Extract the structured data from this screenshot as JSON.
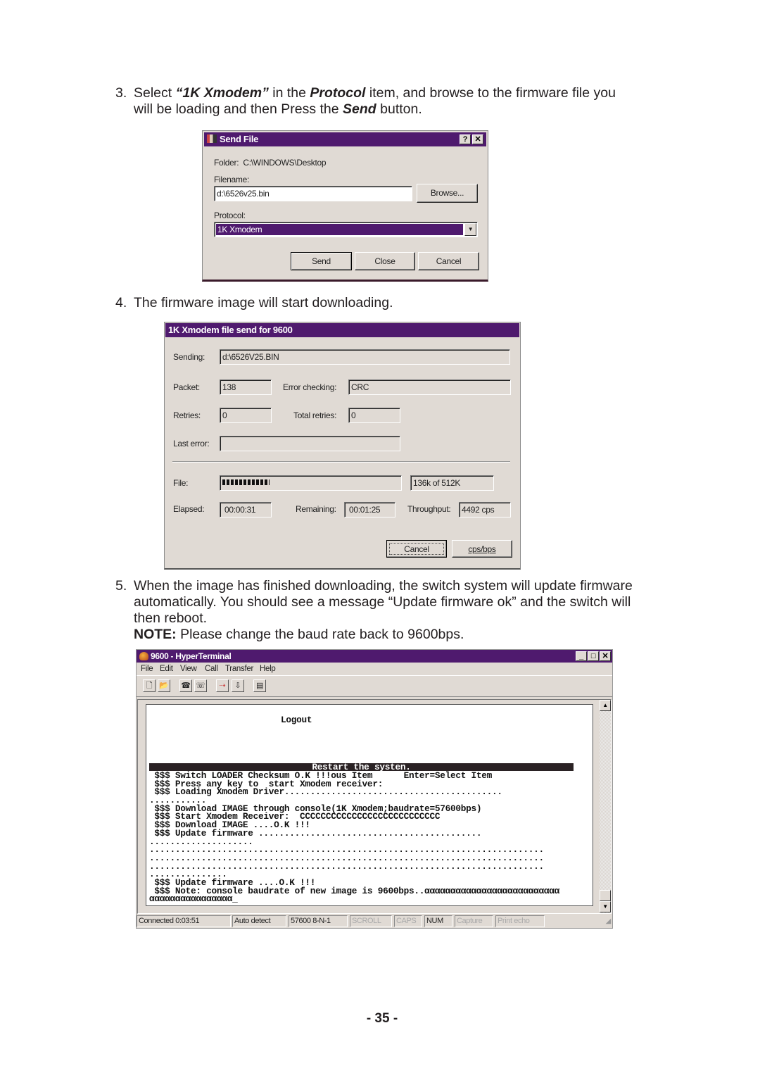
{
  "steps": {
    "step3": {
      "number": "3.",
      "line1_a": "Select ",
      "line1_b": "“1K Xmodem”",
      "line1_c": " in the ",
      "line1_d": "Protocol",
      "line1_e": " item, and browse to the firmware file you",
      "line2_a": "will be loading and then Press the ",
      "line2_b": "Send",
      "line2_c": " button."
    },
    "step4": {
      "number": "4.",
      "text": "The firmware image will start downloading."
    },
    "step5": {
      "number": "5.",
      "line1": "When the image has finished downloading, the switch system will update firmware",
      "line2": "automatically. You should see a message “Update firmware ok” and the switch will",
      "line3": "then reboot.",
      "note_label": "NOTE:",
      "note_text": " Please change the baud rate back to 9600bps."
    }
  },
  "send_file_dialog": {
    "title": "Send File",
    "help_button": "?",
    "close_button": "✕",
    "folder_label": "Folder:",
    "folder_value": "C:\\WINDOWS\\Desktop",
    "filename_label": "Filename:",
    "filename_value": "d:\\6526v25.bin",
    "browse_button": "Browse...",
    "protocol_label": "Protocol:",
    "protocol_value": "1K Xmodem",
    "send_button": "Send",
    "close_btn": "Close",
    "cancel_button": "Cancel"
  },
  "xmodem_dialog": {
    "title": "1K Xmodem file send for 9600",
    "sending_label": "Sending:",
    "sending_value": "d:\\6526V25.BIN",
    "packet_label": "Packet:",
    "packet_value": "138",
    "error_checking_label": "Error checking:",
    "error_checking_value": "CRC",
    "retries_label": "Retries:",
    "retries_value": "0",
    "total_retries_label": "Total retries:",
    "total_retries_value": "0",
    "last_error_label": "Last error:",
    "last_error_value": "",
    "file_label": "File:",
    "file_progress_fraction": 0.2656,
    "file_size_value": "136k of 512K",
    "elapsed_label": "Elapsed:",
    "elapsed_value": "00:00:31",
    "remaining_label": "Remaining:",
    "remaining_value": "00:01:25",
    "throughput_label": "Throughput:",
    "throughput_value": "4492 cps",
    "cancel_button": "Cancel",
    "cps_bps_button": "cps/bps"
  },
  "hyperterminal": {
    "title": "9600 - HyperTerminal",
    "menu": [
      "File",
      "Edit",
      "View",
      "Call",
      "Transfer",
      "Help"
    ],
    "toolbar_icons": [
      "new-icon",
      "open-icon",
      "call-icon",
      "disconnect-icon",
      "send-icon",
      "receive-icon",
      "properties-icon"
    ],
    "terminal": {
      "logout": "Logout",
      "banner": "Restart the systen.",
      "lines": [
        " $$$ Switch LOADER Checksum O.K !!!ous Item      Enter=Select Item",
        " $$$ Press any key to  start Xmodem receiver:",
        " $$$ Loading Xmodem Driver..........................................",
        "...........",
        " $$$ Download IMAGE through console(1K Xmodem;baudrate=57600bps)",
        " $$$ Start Xmodem Receiver:  CCCCCCCCCCCCCCCCCCCCCCCCCCC",
        " $$$ Download IMAGE ....O.K !!!",
        " $$$ Update firmware ...........................................",
        "....................",
        "............................................................................",
        "............................................................................",
        "............................................................................",
        "...............",
        " $$$ Update firmware ....O.K !!!",
        " $$$ Note: console baudrate of new image is 9600bps..αααααααααααααααααααααααααα",
        "αααααααααααααααα_"
      ]
    },
    "status_bar": [
      "Connected 0:03:51",
      "Auto detect",
      "57600 8-N-1",
      "SCROLL",
      "CAPS",
      "NUM",
      "Capture",
      "Print echo"
    ]
  },
  "page_number": "- 35 -",
  "colors": {
    "titlebar": "#4f1a6e",
    "dialog_bg": "#e0dad4"
  }
}
